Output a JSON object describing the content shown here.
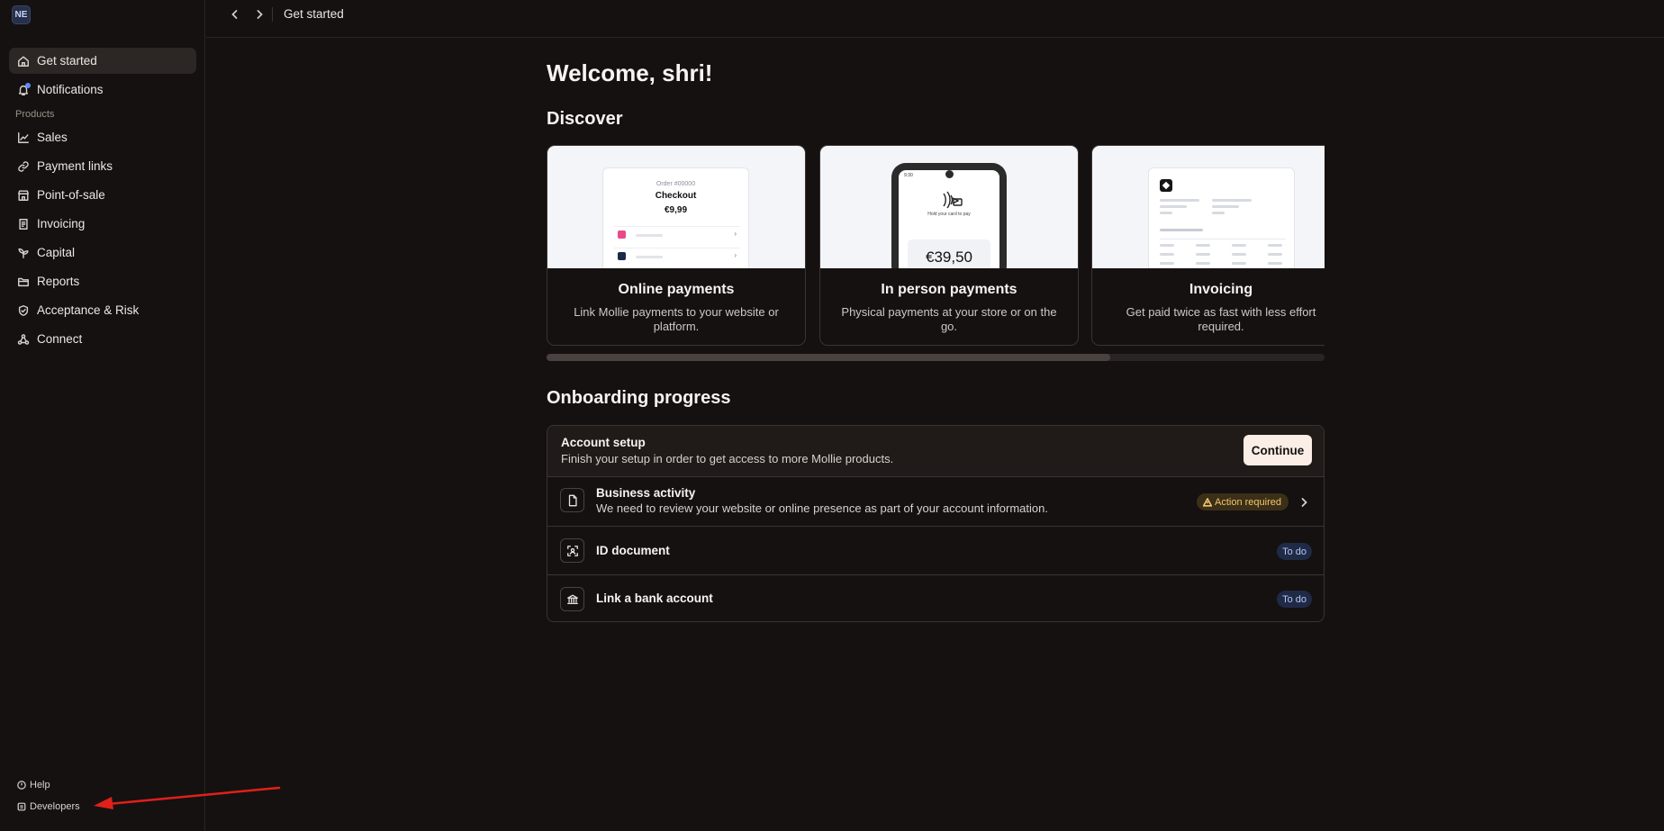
{
  "org": {
    "initials": "NE"
  },
  "sidebar": {
    "top_items": [
      {
        "label": "Get started",
        "icon": "home-icon",
        "active": true
      },
      {
        "label": "Notifications",
        "icon": "bell-icon",
        "active": false
      }
    ],
    "section_label": "Products",
    "product_items": [
      {
        "label": "Sales",
        "icon": "chart-line-icon"
      },
      {
        "label": "Payment links",
        "icon": "link-icon"
      },
      {
        "label": "Point-of-sale",
        "icon": "store-icon"
      },
      {
        "label": "Invoicing",
        "icon": "invoice-icon"
      },
      {
        "label": "Capital",
        "icon": "sprout-icon"
      },
      {
        "label": "Reports",
        "icon": "folder-icon"
      },
      {
        "label": "Acceptance & Risk",
        "icon": "shield-icon"
      },
      {
        "label": "Connect",
        "icon": "connect-icon"
      }
    ],
    "bottom_items": [
      {
        "label": "Help",
        "icon": "help-icon"
      },
      {
        "label": "Developers",
        "icon": "code-icon"
      }
    ]
  },
  "topbar": {
    "title": "Get started"
  },
  "main": {
    "welcome": "Welcome, shri!",
    "discover_title": "Discover",
    "cards": [
      {
        "title": "Online payments",
        "description": "Link Mollie payments to your website or platform.",
        "mock": {
          "order": "Order #00000",
          "checkout": "Checkout",
          "price": "€9,99"
        }
      },
      {
        "title": "In person payments",
        "description": "Physical payments at your store or on the go.",
        "mock": {
          "time": "9:30",
          "hold": "Hold your card to pay",
          "amount": "€39,50"
        }
      },
      {
        "title": "Invoicing",
        "description": "Get paid twice as fast with less effort required."
      }
    ],
    "carousel_progress": 0.725,
    "onboarding_title": "Onboarding progress",
    "onboarding": {
      "header_title": "Account setup",
      "header_subtitle": "Finish your setup in order to get access to more Mollie products.",
      "continue_label": "Continue",
      "tasks": [
        {
          "title": "Business activity",
          "subtitle": "We need to review your website or online presence as part of your account information.",
          "badge": "Action required",
          "icon": "document-icon"
        },
        {
          "title": "ID document",
          "badge": "To do",
          "icon": "face-scan-icon"
        },
        {
          "title": "Link a bank account",
          "badge": "To do",
          "icon": "bank-icon"
        }
      ]
    }
  },
  "colors": {
    "background": "#151110",
    "accent_continue": "#fbeee6",
    "action_badge": "#f2c56b",
    "todo_badge": "#b9c7f2",
    "annotation": "#e0201a"
  }
}
